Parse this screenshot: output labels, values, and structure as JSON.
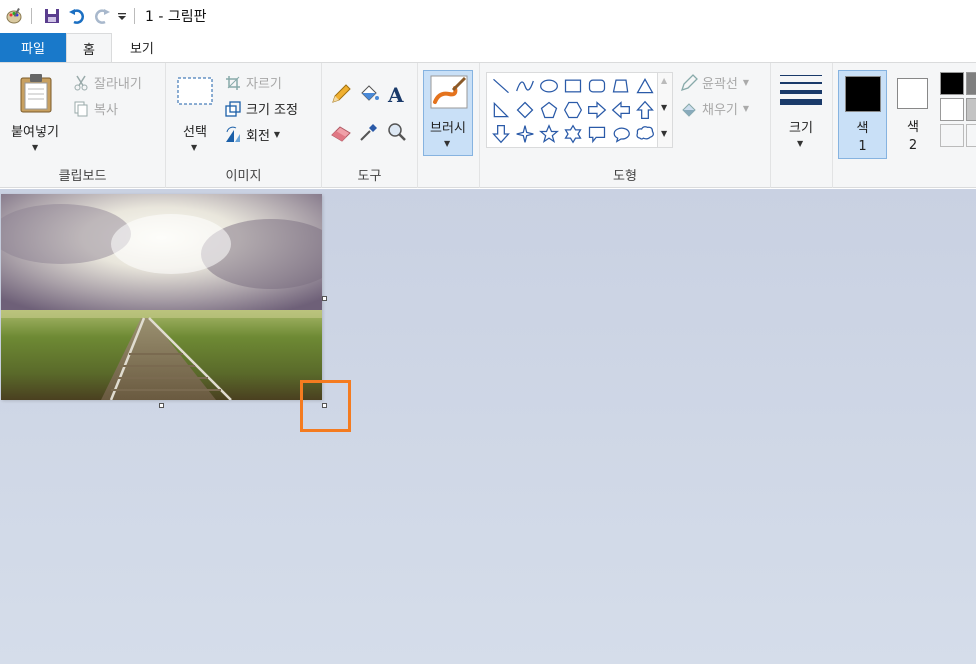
{
  "window": {
    "title": "1 - 그림판"
  },
  "tabs": {
    "file": "파일",
    "home": "홈",
    "view": "보기"
  },
  "clipboard": {
    "paste": "붙여넣기",
    "cut": "잘라내기",
    "copy": "복사",
    "label": "클립보드"
  },
  "image": {
    "select": "선택",
    "crop": "자르기",
    "resize": "크기 조정",
    "rotate": "회전",
    "label": "이미지"
  },
  "tools": {
    "label": "도구"
  },
  "brushes": {
    "label": "브러시"
  },
  "shapes": {
    "outline": "윤곽선",
    "fill": "채우기",
    "label": "도형"
  },
  "size": {
    "label": "크기"
  },
  "colors": {
    "color1": "색",
    "color1_num": "1",
    "color2": "색",
    "color2_num": "2",
    "active_color": "#000000",
    "secondary_color": "#ffffff"
  },
  "accent": {
    "file_tab": "#1979ca",
    "highlight": "#f47b20"
  }
}
